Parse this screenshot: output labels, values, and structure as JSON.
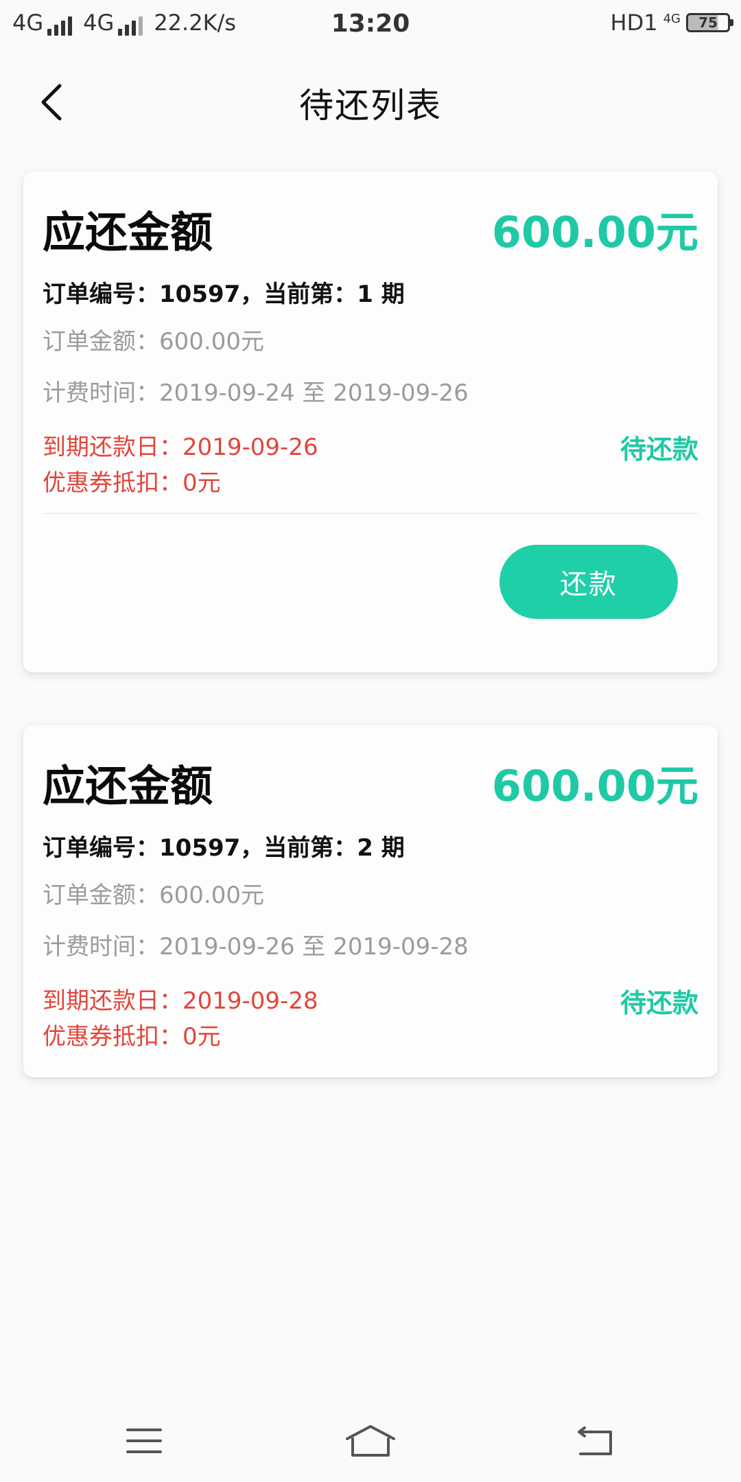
{
  "status_bar": {
    "network_1": "4G",
    "network_2": "4G",
    "speed": "22.2K/s",
    "time": "13:20",
    "hd_label": "HD1",
    "small_4g": "4G",
    "battery": "75"
  },
  "header": {
    "title": "待还列表",
    "back_icon": "chevron-left-icon"
  },
  "cards": [
    {
      "amount_label": "应还金额",
      "amount_value": "600.00元",
      "order_line": "订单编号：10597，当前第：1 期",
      "order_amount": "订单金额：600.00元",
      "billing_period": "计费时间：2019-09-24 至 2019-09-26",
      "due_date": "到期还款日：2019-09-26",
      "coupon": "优惠券抵扣：0元",
      "status": "待还款",
      "button_label": "还款"
    },
    {
      "amount_label": "应还金额",
      "amount_value": "600.00元",
      "order_line": "订单编号：10597，当前第：2 期",
      "order_amount": "订单金额：600.00元",
      "billing_period": "计费时间：2019-09-26 至 2019-09-28",
      "due_date": "到期还款日：2019-09-28",
      "coupon": "优惠券抵扣：0元",
      "status": "待还款"
    }
  ],
  "nav_bar": {
    "icons": [
      "menu-icon",
      "home-icon",
      "back-icon"
    ]
  },
  "colors": {
    "accent": "#1fc9a6",
    "warning": "#e2453b",
    "muted": "#9b9b9b"
  }
}
